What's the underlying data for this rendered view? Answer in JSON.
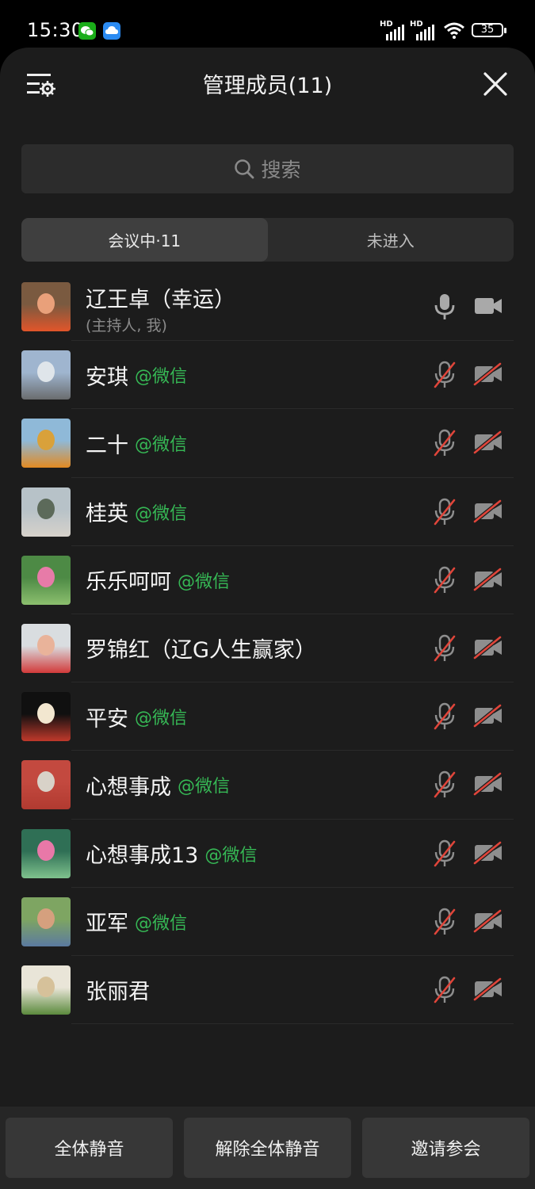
{
  "status_bar": {
    "time": "15:30",
    "battery": "35",
    "signal_label_1": "HD",
    "signal_label_2": "HD"
  },
  "header": {
    "title": "管理成员(11)"
  },
  "search": {
    "placeholder": "搜索"
  },
  "tabs": [
    {
      "label": "会议中·11",
      "active": true
    },
    {
      "label": "未进入",
      "active": false
    }
  ],
  "members": [
    {
      "name": "辽王卓（幸运）",
      "tag": "",
      "subtitle": "(主持人, 我)",
      "mic": "on",
      "camera": "on"
    },
    {
      "name": "安琪",
      "tag": "@微信",
      "mic": "off",
      "camera": "off"
    },
    {
      "name": "二十",
      "tag": "@微信",
      "mic": "off",
      "camera": "off"
    },
    {
      "name": "桂英",
      "tag": "@微信",
      "mic": "off",
      "camera": "off"
    },
    {
      "name": "乐乐呵呵",
      "tag": "@微信",
      "mic": "off",
      "camera": "off"
    },
    {
      "name": "罗锦红（辽G人生赢家）",
      "tag": "",
      "mic": "off",
      "camera": "off"
    },
    {
      "name": "平安",
      "tag": "@微信",
      "mic": "off",
      "camera": "off"
    },
    {
      "name": "心想事成",
      "tag": "@微信",
      "mic": "off",
      "camera": "off"
    },
    {
      "name": "心想事成13",
      "tag": "@微信",
      "mic": "off",
      "camera": "off"
    },
    {
      "name": "亚军",
      "tag": "@微信",
      "mic": "off",
      "camera": "off"
    },
    {
      "name": "张丽君",
      "tag": "",
      "mic": "off",
      "camera": "off"
    }
  ],
  "footer": {
    "mute_all": "全体静音",
    "unmute_all": "解除全体静音",
    "invite": "邀请参会"
  },
  "colors": {
    "accent_green": "#36b855",
    "muted_red": "#e0453a",
    "sheet_bg": "#1c1c1c"
  }
}
